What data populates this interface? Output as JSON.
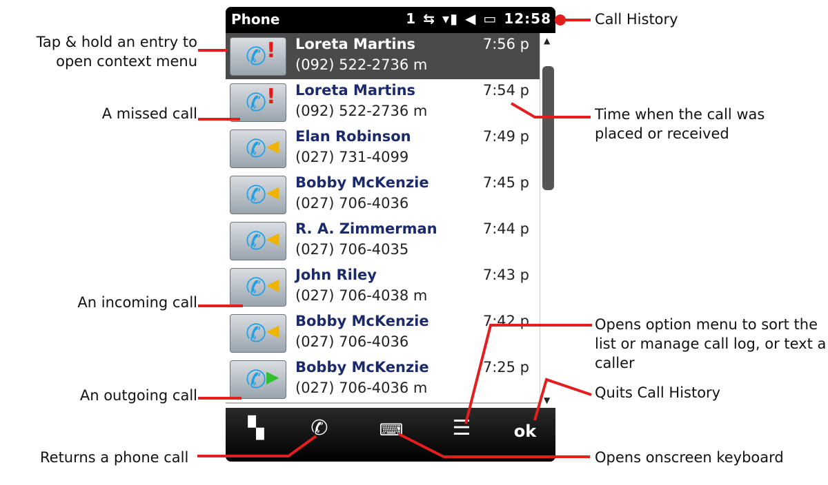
{
  "status_bar": {
    "app_title": "Phone",
    "line_indicator": "1",
    "clock": "12:58",
    "icon_names": [
      "data-connection-icon",
      "signal-strength-icon",
      "speaker-muted-icon",
      "battery-charging-icon"
    ]
  },
  "call_history": {
    "entries": [
      {
        "name": "Loreta Martins",
        "number": "(092) 522-2736 m",
        "time": "7:56 p",
        "type": "missed",
        "selected": true
      },
      {
        "name": "Loreta Martins",
        "number": "(092) 522-2736 m",
        "time": "7:54 p",
        "type": "missed",
        "selected": false
      },
      {
        "name": "Elan Robinson",
        "number": "(027) 731-4099",
        "time": "7:49 p",
        "type": "incoming",
        "selected": false
      },
      {
        "name": "Bobby McKenzie",
        "number": "(027) 706-4036",
        "time": "7:45 p",
        "type": "incoming",
        "selected": false
      },
      {
        "name": "R. A. Zimmerman",
        "number": "(027) 706-4035",
        "time": "7:44 p",
        "type": "incoming",
        "selected": false
      },
      {
        "name": "John Riley",
        "number": "(027) 706-4038 m",
        "time": "7:43 p",
        "type": "incoming",
        "selected": false
      },
      {
        "name": "Bobby McKenzie",
        "number": "(027) 706-4036",
        "time": "7:42 p",
        "type": "incoming",
        "selected": false
      },
      {
        "name": "Bobby McKenzie",
        "number": "(027) 706-4036 m",
        "time": "7:25 p",
        "type": "outgoing",
        "selected": false
      }
    ]
  },
  "softkeys": {
    "ok_label": "ok",
    "icon_names": [
      "windows-start-icon",
      "phone-handset-icon",
      "keyboard-icon",
      "menu-icon"
    ]
  },
  "annotations": {
    "call_history": "Call History",
    "context_menu": "Tap & hold an entry to open context menu",
    "missed_call": "A missed call",
    "incoming_call": "An incoming call",
    "outgoing_call": "An outgoing call",
    "time_placed": "Time when the call was placed or received",
    "option_menu": "Opens option menu to sort the list or manage call log, or text a caller",
    "quits": "Quits Call History",
    "returns_call": "Returns a phone call",
    "keyboard": "Opens onscreen keyboard"
  },
  "colors": {
    "callout_line": "#e31e1e",
    "selected_row": "#4a4a4a",
    "name_text": "#1b2a6b",
    "missed_mark": "#e21b1b",
    "incoming_mark": "#f0b400",
    "outgoing_mark": "#2fbf2f"
  }
}
